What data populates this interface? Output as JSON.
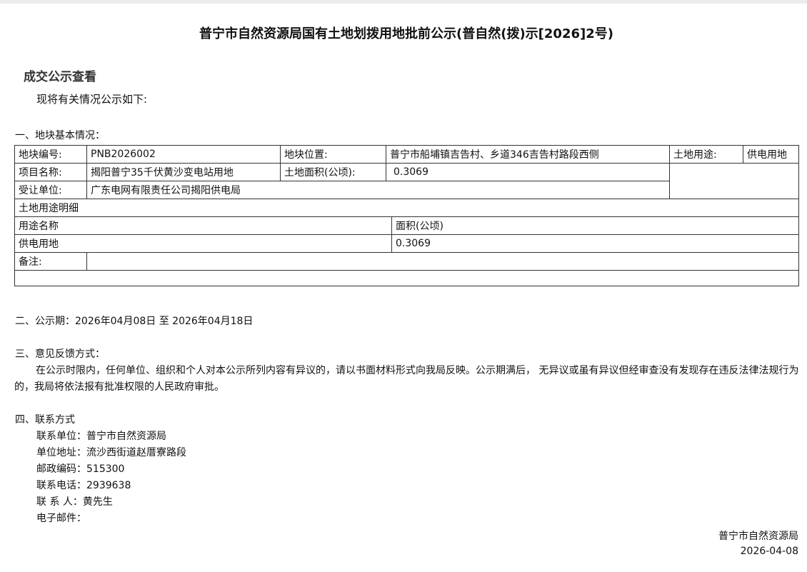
{
  "title": "普宁市自然资源局国有土地划拨用地批前公示(普自然(拨)示[2026]2号)",
  "heading": "成交公示查看",
  "intro": "现将有关情况公示如下:",
  "section1": {
    "title": "一、地块基本情况：",
    "labels": {
      "parcel_no": "地块编号:",
      "location": "地块位置:",
      "land_use": "土地用途:",
      "project": "项目名称:",
      "area": "土地面积(公顷):",
      "grantee": "受让单位:",
      "use_detail": "土地用途明细",
      "use_name": "用途名称",
      "use_area": "面积(公顷)",
      "remarks": "备注:"
    },
    "values": {
      "parcel_no": "PNB2026002",
      "location": "普宁市船埔镇吉告村、乡道346吉告村路段西侧",
      "land_use": "供电用地",
      "project": "揭阳普宁35千伏黄沙变电站用地",
      "area": "0.3069",
      "grantee": "广东电网有限责任公司揭阳供电局",
      "remarks": ""
    },
    "use_rows": [
      {
        "name": "供电用地",
        "area": "0.3069"
      }
    ]
  },
  "section2": {
    "text": "二、公示期：2026年04月08日 至 2026年04月18日"
  },
  "section3": {
    "title": "三、意见反馈方式：",
    "body": "在公示时限内，任何单位、组织和个人对本公示所列内容有异议的，请以书面材料形式向我局反映。公示期满后， 无异议或虽有异议但经审查没有发现存在违反法律法规行为的，我局将依法报有批准权限的人民政府审批。"
  },
  "section4": {
    "title": "四、联系方式",
    "unit": "联系单位：普宁市自然资源局",
    "address": "单位地址：流沙西街道赵厝寮路段",
    "postcode": "邮政编码：515300",
    "phone": "联系电话：2939638",
    "contact": "联 系 人：黄先生",
    "email": "电子邮件："
  },
  "signature": {
    "org": "普宁市自然资源局",
    "date": "2026-04-08"
  }
}
